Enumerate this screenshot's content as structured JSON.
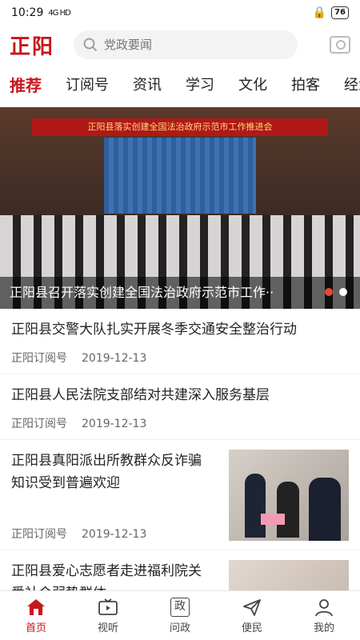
{
  "status": {
    "time": "10:29",
    "network": "4G HD",
    "battery": "76"
  },
  "header": {
    "logo": "正阳",
    "search_placeholder": "党政要闻"
  },
  "tabs": [
    {
      "label": "推荐",
      "active": true
    },
    {
      "label": "订阅号"
    },
    {
      "label": "资讯"
    },
    {
      "label": "学习"
    },
    {
      "label": "文化"
    },
    {
      "label": "拍客"
    },
    {
      "label": "经济"
    }
  ],
  "banner": {
    "stage_text": "正阳县落实创建全国法治政府示范市工作推进会",
    "caption": "正阳县召开落实创建全国法治政府示范市工作··",
    "dots": 2
  },
  "news": [
    {
      "title": "正阳县交警大队扎实开展冬季交通安全整治行动",
      "source": "正阳订阅号",
      "date": "2019-12-13"
    },
    {
      "title": "正阳县人民法院支部结对共建深入服务基层",
      "source": "正阳订阅号",
      "date": "2019-12-13"
    },
    {
      "title": "正阳县真阳派出所教群众反诈骗知识受到普遍欢迎",
      "source": "正阳订阅号",
      "date": "2019-12-13"
    },
    {
      "title": "正阳县爱心志愿者走进福利院关爱社会弱势群体"
    }
  ],
  "bottom_nav": [
    {
      "label": "首页",
      "icon": "home-icon",
      "active": true
    },
    {
      "label": "视听",
      "icon": "tv-icon"
    },
    {
      "label": "问政",
      "icon": "zheng-icon",
      "glyph": "政"
    },
    {
      "label": "便民",
      "icon": "send-icon"
    },
    {
      "label": "我的",
      "icon": "user-icon"
    }
  ],
  "colors": {
    "brand": "#c8161d"
  }
}
